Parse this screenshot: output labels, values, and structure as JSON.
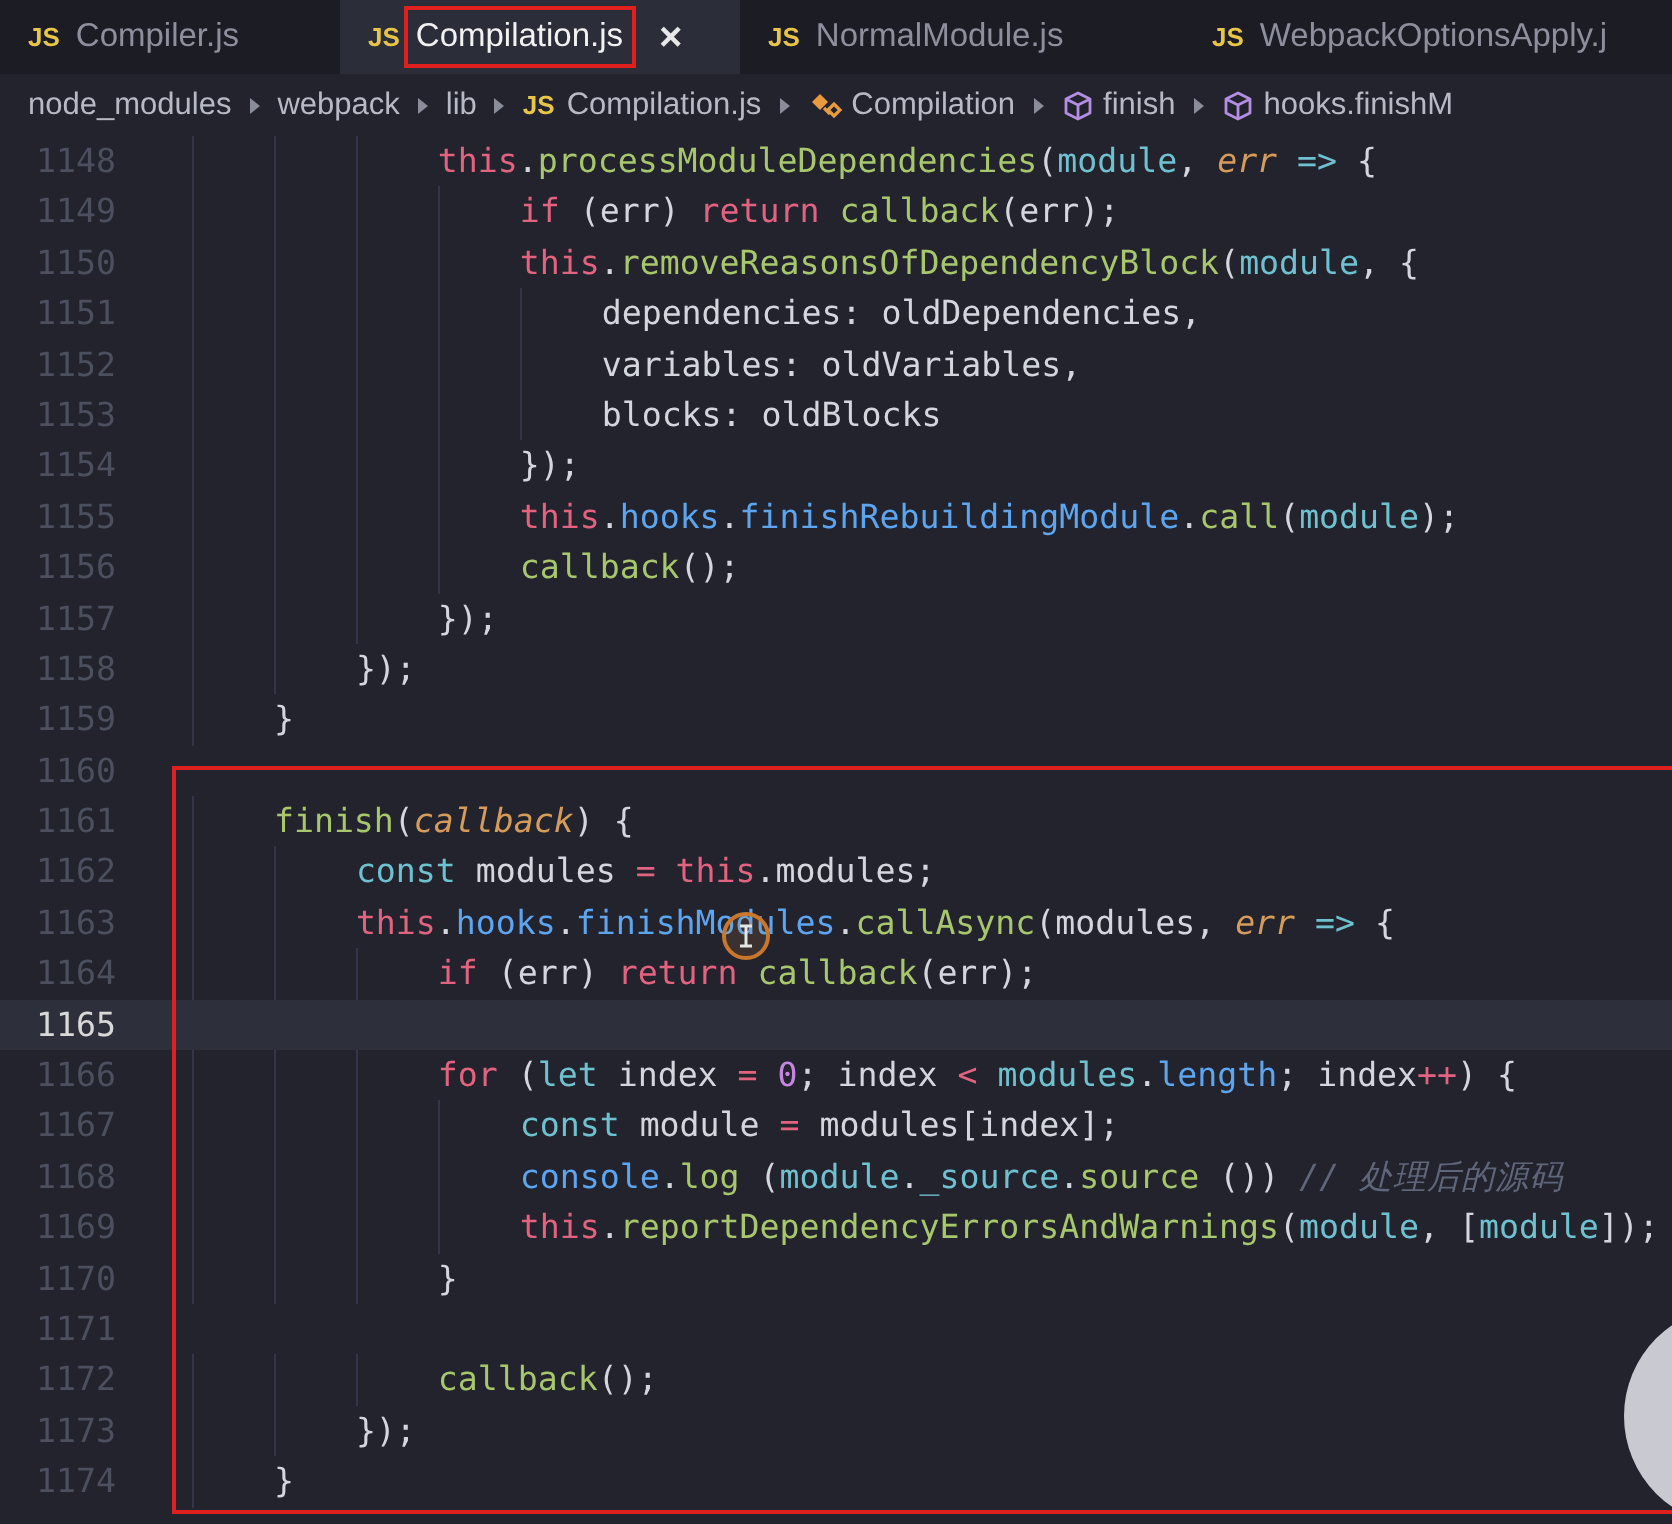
{
  "tabs": [
    {
      "icon_label": "JS",
      "label": "Compiler.js",
      "selected": false
    },
    {
      "icon_label": "JS",
      "label": "Compilation.js",
      "selected": true,
      "close": "×"
    },
    {
      "icon_label": "JS",
      "label": "NormalModule.js",
      "selected": false
    },
    {
      "icon_label": "JS",
      "label": "WebpackOptionsApply.j",
      "selected": false
    }
  ],
  "breadcrumb": [
    {
      "kind": "folder",
      "label": "node_modules"
    },
    {
      "kind": "folder",
      "label": "webpack"
    },
    {
      "kind": "folder",
      "label": "lib"
    },
    {
      "kind": "file",
      "icon_label": "JS",
      "label": "Compilation.js"
    },
    {
      "kind": "class",
      "label": "Compilation"
    },
    {
      "kind": "method",
      "label": "finish"
    },
    {
      "kind": "method",
      "label": "hooks.finishM"
    }
  ],
  "code_lines": [
    {
      "number": "1148",
      "current": false,
      "tokens": [
        {
          "text": "            this",
          "kind": "kw"
        },
        {
          "text": ".",
          "kind": "plain"
        },
        {
          "text": "processModuleDependencies",
          "kind": "fn"
        },
        {
          "text": "(",
          "kind": "plain"
        },
        {
          "text": "module",
          "kind": "var"
        },
        {
          "text": ", ",
          "kind": "plain"
        },
        {
          "text": "err",
          "kind": "param"
        },
        {
          "text": " =>",
          "kind": "var"
        },
        {
          "text": " {",
          "kind": "plain"
        }
      ]
    },
    {
      "number": "1149",
      "current": false,
      "tokens": [
        {
          "text": "                if",
          "kind": "kw"
        },
        {
          "text": " (err) ",
          "kind": "plain"
        },
        {
          "text": "return",
          "kind": "kw"
        },
        {
          "text": " callback",
          "kind": "fn"
        },
        {
          "text": "(err);",
          "kind": "plain"
        }
      ]
    },
    {
      "number": "1150",
      "current": false,
      "tokens": [
        {
          "text": "                this",
          "kind": "kw"
        },
        {
          "text": ".",
          "kind": "plain"
        },
        {
          "text": "removeReasonsOfDependencyBlock",
          "kind": "fn"
        },
        {
          "text": "(",
          "kind": "plain"
        },
        {
          "text": "module",
          "kind": "var"
        },
        {
          "text": ", {",
          "kind": "plain"
        }
      ]
    },
    {
      "number": "1151",
      "current": false,
      "tokens": [
        {
          "text": "                    dependencies: oldDependencies,",
          "kind": "plain"
        }
      ]
    },
    {
      "number": "1152",
      "current": false,
      "tokens": [
        {
          "text": "                    variables: oldVariables,",
          "kind": "plain"
        }
      ]
    },
    {
      "number": "1153",
      "current": false,
      "tokens": [
        {
          "text": "                    blocks: oldBlocks",
          "kind": "plain"
        }
      ]
    },
    {
      "number": "1154",
      "current": false,
      "tokens": [
        {
          "text": "                });",
          "kind": "plain"
        }
      ]
    },
    {
      "number": "1155",
      "current": false,
      "tokens": [
        {
          "text": "                this",
          "kind": "kw"
        },
        {
          "text": ".",
          "kind": "plain"
        },
        {
          "text": "hooks",
          "kind": "prop"
        },
        {
          "text": ".",
          "kind": "plain"
        },
        {
          "text": "finishRebuildingModule",
          "kind": "prop"
        },
        {
          "text": ".",
          "kind": "plain"
        },
        {
          "text": "call",
          "kind": "fn"
        },
        {
          "text": "(",
          "kind": "plain"
        },
        {
          "text": "module",
          "kind": "var"
        },
        {
          "text": ");",
          "kind": "plain"
        }
      ]
    },
    {
      "number": "1156",
      "current": false,
      "tokens": [
        {
          "text": "                callback",
          "kind": "fn"
        },
        {
          "text": "();",
          "kind": "plain"
        }
      ]
    },
    {
      "number": "1157",
      "current": false,
      "tokens": [
        {
          "text": "            });",
          "kind": "plain"
        }
      ]
    },
    {
      "number": "1158",
      "current": false,
      "tokens": [
        {
          "text": "        });",
          "kind": "plain"
        }
      ]
    },
    {
      "number": "1159",
      "current": false,
      "tokens": [
        {
          "text": "    }",
          "kind": "plain"
        }
      ]
    },
    {
      "number": "1160",
      "current": false
    },
    {
      "number": "1161",
      "current": false,
      "tokens": [
        {
          "text": "    finish",
          "kind": "fn"
        },
        {
          "text": "(",
          "kind": "plain"
        },
        {
          "text": "callback",
          "kind": "param"
        },
        {
          "text": ") {",
          "kind": "plain"
        }
      ]
    },
    {
      "number": "1162",
      "current": false,
      "tokens": [
        {
          "text": "        const",
          "kind": "var"
        },
        {
          "text": " modules ",
          "kind": "plain"
        },
        {
          "text": "= this",
          "kind": "kw"
        },
        {
          "text": ".modules;",
          "kind": "plain"
        }
      ]
    },
    {
      "number": "1163",
      "current": false,
      "tokens": [
        {
          "text": "        this",
          "kind": "kw"
        },
        {
          "text": ".",
          "kind": "plain"
        },
        {
          "text": "hooks",
          "kind": "prop"
        },
        {
          "text": ".",
          "kind": "plain"
        },
        {
          "text": "finishModules",
          "kind": "prop"
        },
        {
          "text": ".",
          "kind": "plain"
        },
        {
          "text": "callAsync",
          "kind": "fn"
        },
        {
          "text": "(modules, ",
          "kind": "plain"
        },
        {
          "text": "err",
          "kind": "param"
        },
        {
          "text": " =>",
          "kind": "var"
        },
        {
          "text": " {",
          "kind": "plain"
        }
      ]
    },
    {
      "number": "1164",
      "current": false,
      "tokens": [
        {
          "text": "            if",
          "kind": "kw"
        },
        {
          "text": " (err) ",
          "kind": "plain"
        },
        {
          "text": "return",
          "kind": "kw"
        },
        {
          "text": " callback",
          "kind": "fn"
        },
        {
          "text": "(err);",
          "kind": "plain"
        }
      ]
    },
    {
      "number": "1165",
      "current": true
    },
    {
      "number": "1166",
      "current": false,
      "tokens": [
        {
          "text": "            for",
          "kind": "kw"
        },
        {
          "text": " (",
          "kind": "plain"
        },
        {
          "text": "let",
          "kind": "var"
        },
        {
          "text": " index ",
          "kind": "plain"
        },
        {
          "text": "=",
          "kind": "kw"
        },
        {
          "text": " 0",
          "kind": "num"
        },
        {
          "text": "; index ",
          "kind": "plain"
        },
        {
          "text": "<",
          "kind": "kw"
        },
        {
          "text": " modules",
          "kind": "var"
        },
        {
          "text": ".",
          "kind": "plain"
        },
        {
          "text": "length",
          "kind": "prop"
        },
        {
          "text": "; index",
          "kind": "plain"
        },
        {
          "text": "++",
          "kind": "kw"
        },
        {
          "text": ") {",
          "kind": "plain"
        }
      ]
    },
    {
      "number": "1167",
      "current": false,
      "tokens": [
        {
          "text": "                const",
          "kind": "var"
        },
        {
          "text": " module ",
          "kind": "plain"
        },
        {
          "text": "=",
          "kind": "kw"
        },
        {
          "text": " modules[index];",
          "kind": "plain"
        }
      ]
    },
    {
      "number": "1168",
      "current": false,
      "tokens": [
        {
          "text": "                console",
          "kind": "prop"
        },
        {
          "text": ".",
          "kind": "plain"
        },
        {
          "text": "log",
          "kind": "fn"
        },
        {
          "text": " (",
          "kind": "plain"
        },
        {
          "text": "module",
          "kind": "var"
        },
        {
          "text": ".",
          "kind": "plain"
        },
        {
          "text": "_source",
          "kind": "var"
        },
        {
          "text": ".",
          "kind": "plain"
        },
        {
          "text": "source",
          "kind": "fn"
        },
        {
          "text": " ()) ",
          "kind": "plain"
        },
        {
          "text": "// 处理后的源码",
          "kind": "comment"
        }
      ]
    },
    {
      "number": "1169",
      "current": false,
      "tokens": [
        {
          "text": "                this",
          "kind": "kw"
        },
        {
          "text": ".",
          "kind": "plain"
        },
        {
          "text": "reportDependencyErrorsAndWarnings",
          "kind": "fn"
        },
        {
          "text": "(",
          "kind": "plain"
        },
        {
          "text": "module",
          "kind": "var"
        },
        {
          "text": ", [",
          "kind": "plain"
        },
        {
          "text": "module",
          "kind": "var"
        },
        {
          "text": "]);",
          "kind": "plain"
        }
      ]
    },
    {
      "number": "1170",
      "current": false,
      "tokens": [
        {
          "text": "            }",
          "kind": "plain"
        }
      ]
    },
    {
      "number": "1171",
      "current": false
    },
    {
      "number": "1172",
      "current": false,
      "tokens": [
        {
          "text": "            callback",
          "kind": "fn"
        },
        {
          "text": "();",
          "kind": "plain"
        }
      ]
    },
    {
      "number": "1173",
      "current": false,
      "tokens": [
        {
          "text": "        });",
          "kind": "plain"
        }
      ]
    },
    {
      "number": "1174",
      "current": false,
      "tokens": [
        {
          "text": "    }",
          "kind": "plain"
        }
      ]
    }
  ]
}
